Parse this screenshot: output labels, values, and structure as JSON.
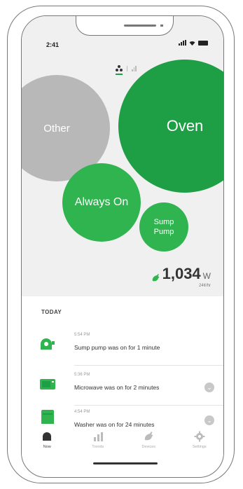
{
  "status": {
    "time": "2:41"
  },
  "bubbles": {
    "other": "Other",
    "oven": "Oven",
    "always_on": "Always On",
    "sump_pump": "Sump Pump"
  },
  "power": {
    "value": "1,034",
    "unit": "W",
    "cost": "24¢/hr"
  },
  "list": {
    "heading": "TODAY",
    "events": [
      {
        "time": "5:54 PM",
        "text": "Sump pump was on for 1 minute",
        "icon": "sump-pump-icon"
      },
      {
        "time": "5:36 PM",
        "text": "Microwave was on for 2 minutes",
        "icon": "microwave-icon"
      },
      {
        "time": "4:54 PM",
        "text": "Washer was on for 24 minutes",
        "icon": "washer-icon"
      }
    ]
  },
  "tabs": [
    {
      "label": "Now",
      "icon": "now-bubbles-icon"
    },
    {
      "label": "Trends",
      "icon": "bar-chart-icon"
    },
    {
      "label": "Devices",
      "icon": "plug-icon"
    },
    {
      "label": "Settings",
      "icon": "gear-icon"
    }
  ],
  "colors": {
    "green": "#1e9e45",
    "green_light": "#2fb44f",
    "gray_bubble": "#b8b8b8",
    "bg_gray": "#f0f0f0"
  }
}
